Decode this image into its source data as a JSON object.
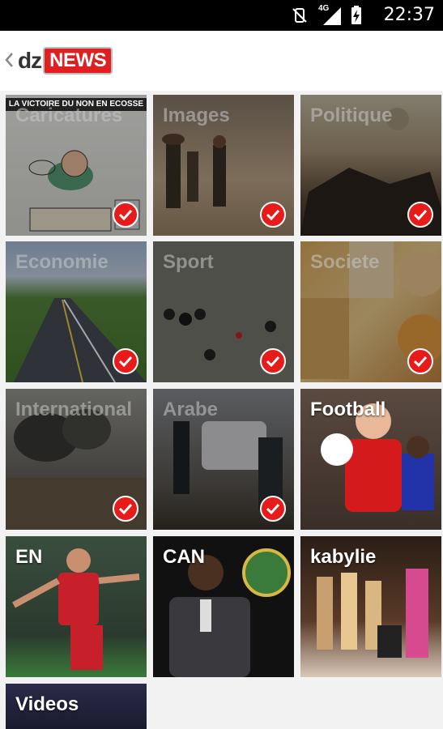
{
  "status_bar": {
    "time": "22:37",
    "network": "4G"
  },
  "app": {
    "logo_dz": "dz",
    "logo_news": "NEWS"
  },
  "caricature_banner": "LA VICTOIRE DU NON EN ECOSSE",
  "categories": [
    {
      "label": "Caricatures",
      "selected": true
    },
    {
      "label": "Images",
      "selected": true
    },
    {
      "label": "Politique",
      "selected": true
    },
    {
      "label": "Economie",
      "selected": true
    },
    {
      "label": "Sport",
      "selected": true
    },
    {
      "label": "Societe",
      "selected": true
    },
    {
      "label": "International",
      "selected": true
    },
    {
      "label": "Arabe",
      "selected": true
    },
    {
      "label": "Football",
      "selected": false
    },
    {
      "label": "EN",
      "selected": false
    },
    {
      "label": "CAN",
      "selected": false
    },
    {
      "label": "kabylie",
      "selected": false
    },
    {
      "label": "Videos",
      "selected": false
    }
  ],
  "colors": {
    "brand_red": "#e02020",
    "check_red": "#e81b1b"
  }
}
